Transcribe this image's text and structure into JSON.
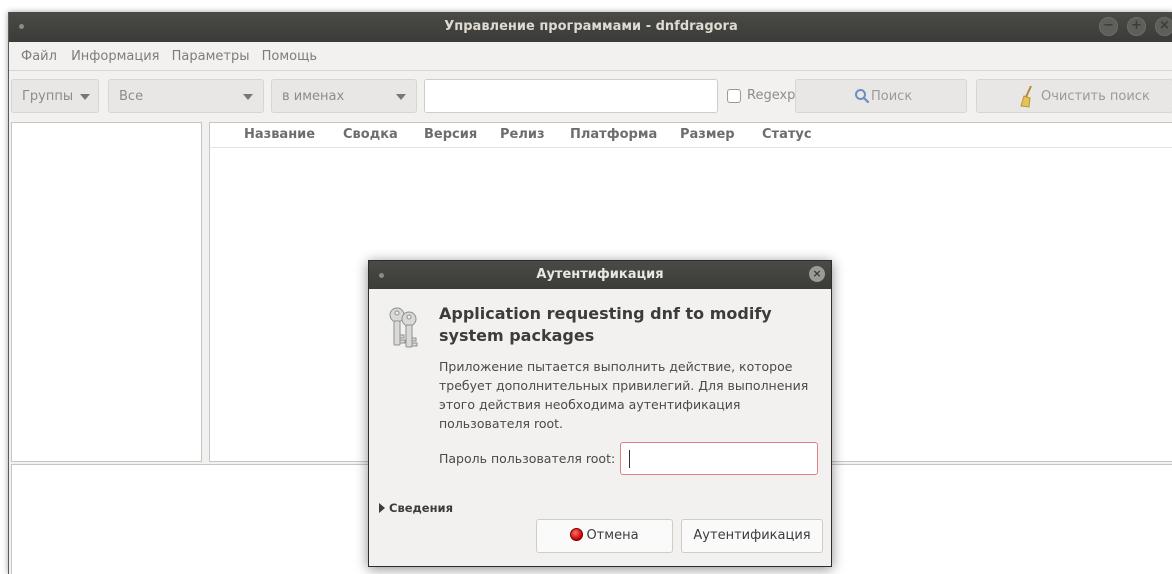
{
  "window": {
    "title": "Управление программами - dnfdragora"
  },
  "menubar": {
    "items": [
      "Файл",
      "Информация",
      "Параметры",
      "Помощь"
    ]
  },
  "toolbar": {
    "groups_label": "Группы",
    "filter_value": "Все",
    "search_scope": "в именах",
    "search_value": "",
    "regexp_label": "Regexp",
    "search_button": "Поиск",
    "clear_button": "Очистить поиск"
  },
  "table": {
    "columns": [
      "Название",
      "Сводка",
      "Версия",
      "Релиз",
      "Платформа",
      "Размер",
      "Статус"
    ]
  },
  "dialog": {
    "title": "Аутентификация",
    "heading": "Application requesting dnf to modify system packages",
    "body": "Приложение пытается выполнить действие, которое требует дополнительных привилегий. Для выполнения этого действия необходима аутентификация пользователя root.",
    "password_label": "Пароль пользователя root:",
    "password_value": "",
    "details_label": "Сведения",
    "cancel_button": "Отмена",
    "auth_button": "Аутентификация"
  }
}
